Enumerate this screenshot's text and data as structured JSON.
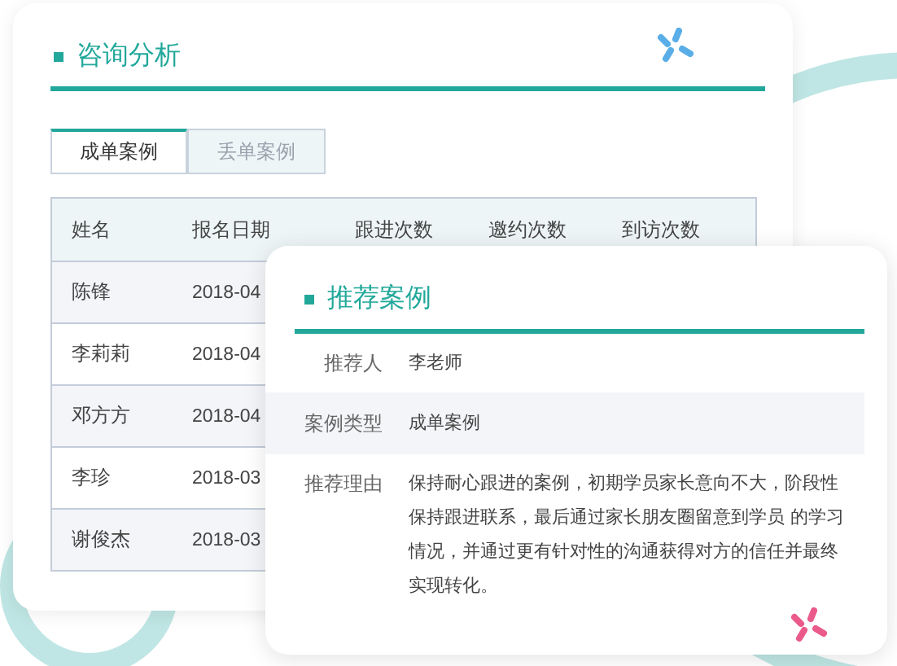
{
  "consult_card": {
    "title": "咨询分析",
    "tabs": [
      {
        "label": "成单案例",
        "selected": true
      },
      {
        "label": "丢单案例",
        "selected": false
      }
    ],
    "table": {
      "columns": [
        "姓名",
        "报名日期",
        "跟进次数",
        "邀约次数",
        "到访次数"
      ],
      "rows": [
        {
          "name": "陈锋",
          "date": "2018-04"
        },
        {
          "name": "李莉莉",
          "date": "2018-04"
        },
        {
          "name": "邓方方",
          "date": "2018-04"
        },
        {
          "name": "李珍",
          "date": "2018-03"
        },
        {
          "name": "谢俊杰",
          "date": "2018-03"
        }
      ]
    }
  },
  "recommend_card": {
    "title": "推荐案例",
    "fields": [
      {
        "label": "推荐人",
        "value": "李老师"
      },
      {
        "label": "案例类型",
        "value": "成单案例"
      },
      {
        "label": "推荐理由",
        "value": "保持耐心跟进的案例，初期学员家长意向不大，阶段性保持跟进联系，最后通过家长朋友圈留意到学员 的学习情况，并通过更有针对性的沟通获得对方的信任并最终实现转化。"
      }
    ]
  }
}
